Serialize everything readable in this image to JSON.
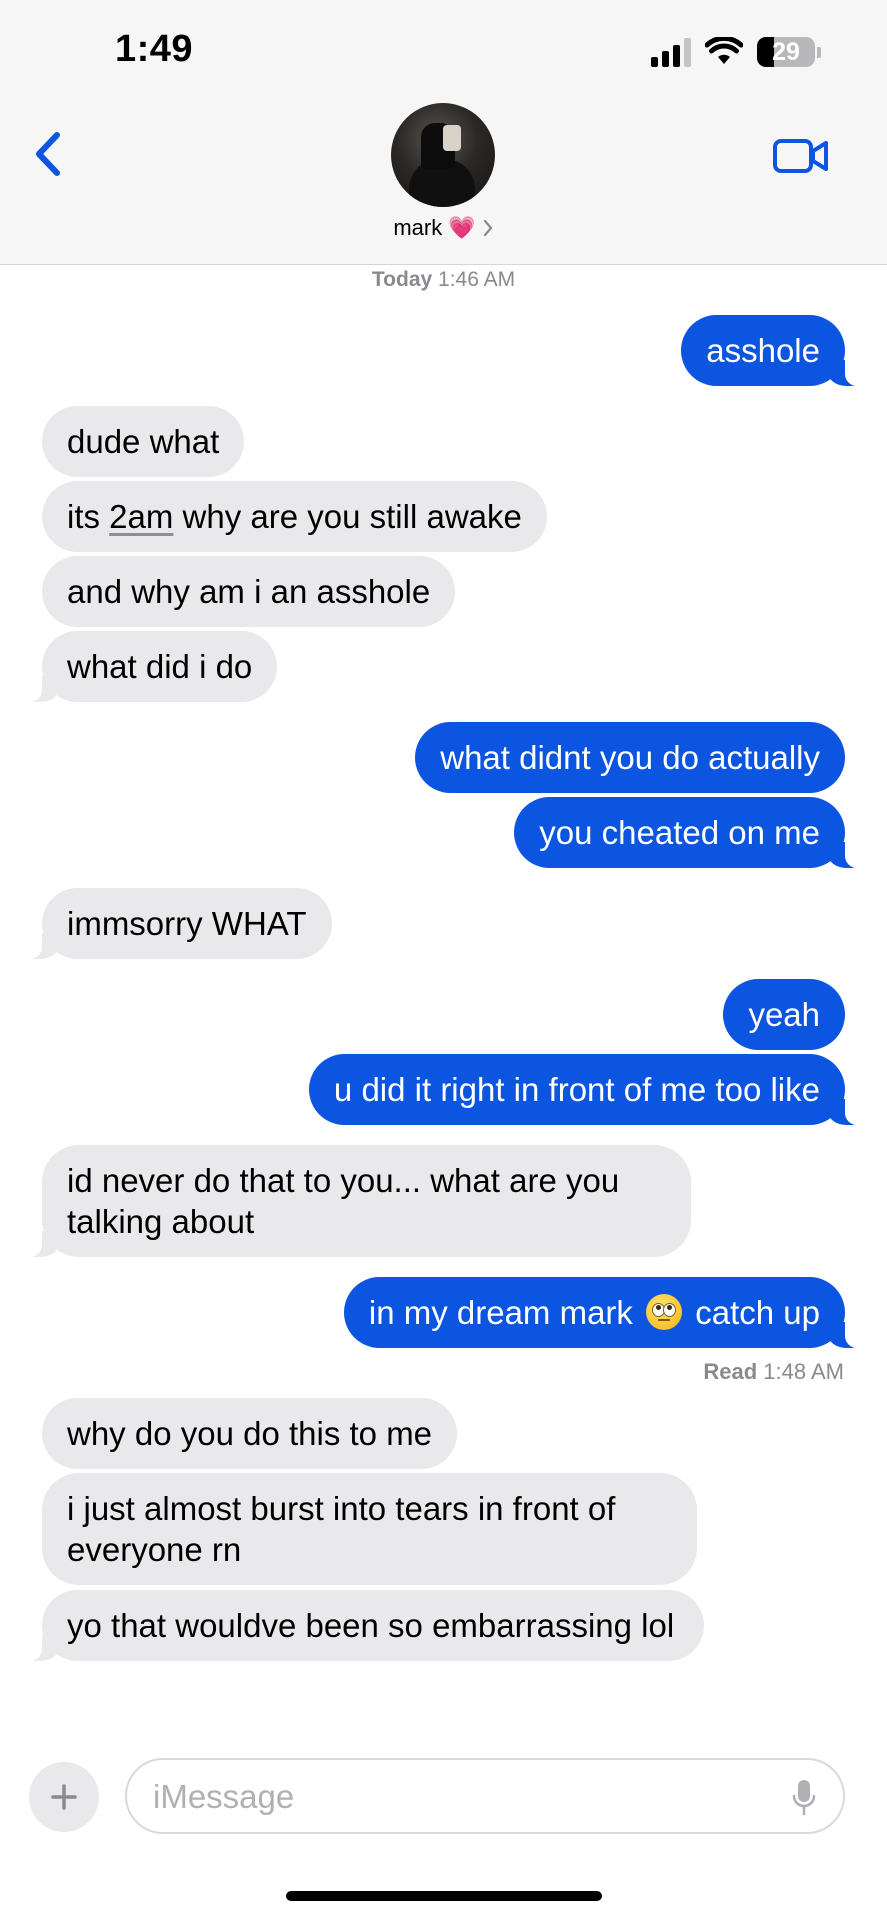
{
  "status_bar": {
    "time": "1:49",
    "battery": "29",
    "battery_level": 0.29
  },
  "header": {
    "contact_name": "mark",
    "contact_emoji": "💗"
  },
  "thread": {
    "timestamp_day": "Today",
    "timestamp_time": "1:46 AM",
    "messages": [
      {
        "from": "me",
        "text": "asshole"
      },
      {
        "from": "them",
        "text": "dude what"
      },
      {
        "from": "them",
        "text_before": "its ",
        "text_link": "2am",
        "text_after": " why are you still awake"
      },
      {
        "from": "them",
        "text": "and why am i an asshole"
      },
      {
        "from": "them",
        "text": "what did i do"
      },
      {
        "from": "me",
        "text": "what didnt you do actually"
      },
      {
        "from": "me",
        "text": "you cheated on me"
      },
      {
        "from": "them",
        "text": "immsorry WHAT"
      },
      {
        "from": "me",
        "text": "yeah"
      },
      {
        "from": "me",
        "text": "u did it right in front of me too like"
      },
      {
        "from": "them",
        "text": "id never do that to you... what are you talking about"
      },
      {
        "from": "me",
        "text_before": "in my dream mark ",
        "emoji": "rolling-eyes-emoji",
        "text_after": " catch up"
      },
      {
        "from": "them",
        "text": "why do you do this to me"
      },
      {
        "from": "them",
        "text": "i just almost burst into tears in front of everyone rn"
      },
      {
        "from": "them",
        "text": "yo that wouldve been so embarrassing lol"
      }
    ],
    "read_label": "Read",
    "read_time": "1:48 AM"
  },
  "compose": {
    "placeholder": "iMessage"
  },
  "colors": {
    "outgoing": "#0b55e0",
    "incoming": "#e9e9eb",
    "accent": "#0b55e0"
  },
  "icons": [
    "back-chevron-icon",
    "video-camera-icon",
    "plus-icon",
    "microphone-icon",
    "cellular-signal-icon",
    "wifi-icon",
    "battery-icon",
    "heart-emoji-icon",
    "chevron-right-icon"
  ]
}
